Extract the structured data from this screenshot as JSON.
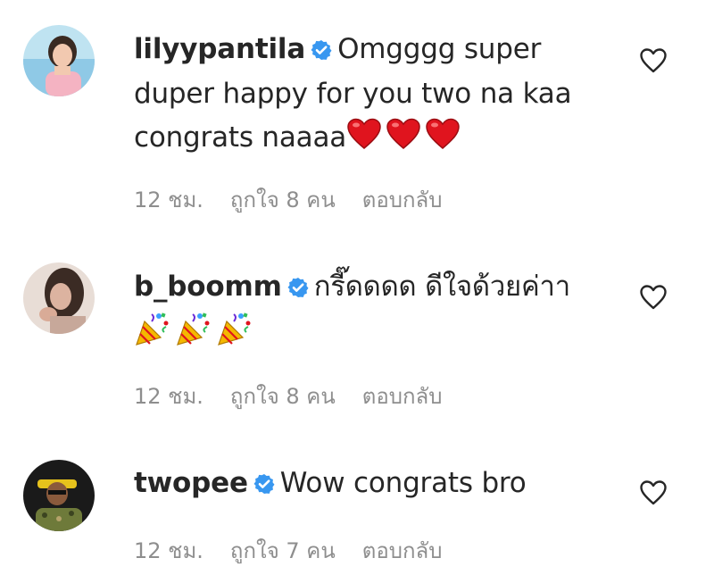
{
  "comments": [
    {
      "username": "lilyypantila",
      "text": "Omgggg super duper happy for you two na kaa congrats naaaa",
      "emojis": [
        "red-heart",
        "red-heart",
        "red-heart"
      ],
      "time": "12 ชม.",
      "likes": "ถูกใจ 8 คน",
      "reply": "ตอบกลับ"
    },
    {
      "username": "b_boomm",
      "text": "กรี๊ดดดด ดีใจด้วยค่าา",
      "emojis": [
        "party-popper",
        "party-popper",
        "party-popper"
      ],
      "time": "12 ชม.",
      "likes": "ถูกใจ 8 คน",
      "reply": "ตอบกลับ"
    },
    {
      "username": "twopee",
      "text": "Wow congrats bro",
      "emojis": [],
      "time": "12 ชม.",
      "likes": "ถูกใจ 7 คน",
      "reply": "ตอบกลับ"
    }
  ],
  "colors": {
    "verified": "#3897f0",
    "meta_text": "#8e8e8e",
    "main_text": "#262626",
    "heart_emoji": "#e0141e"
  }
}
